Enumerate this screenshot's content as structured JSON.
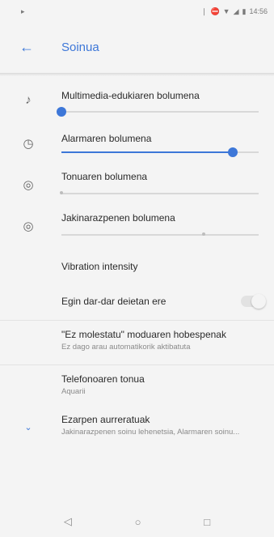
{
  "status_bar": {
    "app_icon": "ringtone-notification-icon",
    "icons": [
      "vibrate-icon",
      "do-not-disturb-icon",
      "wifi-icon",
      "signal-icon",
      "battery-icon"
    ],
    "time": "14:56"
  },
  "app_bar": {
    "back_icon": "back-arrow-icon",
    "title": "Soinua"
  },
  "volume_sliders": [
    {
      "label": "Multimedia-edukiaren bolumena",
      "icon": "music-note-icon",
      "level": 0.0
    },
    {
      "label": "Alarmaren bolumena",
      "icon": "alarm-clock-icon",
      "level": 0.87
    },
    {
      "label": "Tonuaren bolumena",
      "icon": "vibrate-icon",
      "level": 0.0
    },
    {
      "label": "Jakinarazpenen bolumena",
      "icon": "vibrate-icon",
      "level": 0.72
    }
  ],
  "vibration_intensity": {
    "label": "Vibration intensity"
  },
  "vibrate_on_calls": {
    "label": "Egin dar-dar deietan ere",
    "enabled": false
  },
  "dnd_prefs": {
    "title": "\"Ez molestatu\" moduaren hobespenak",
    "subtitle": "Ez dago arau automatikorik aktibatuta"
  },
  "ringtone": {
    "title": "Telefonoaren tonua",
    "subtitle": "Aquarii"
  },
  "advanced": {
    "icon": "chevron-down-icon",
    "title": "Ezarpen aurreratuak",
    "subtitle": "Jakinarazpenen soinu lehenetsia, Alarmaren soinu..."
  },
  "nav_bar": {
    "back": "nav-back-icon",
    "home": "nav-home-icon",
    "recents": "nav-recents-icon"
  },
  "colors": {
    "accent": "#3d77d8",
    "background": "#f4f4f4"
  }
}
